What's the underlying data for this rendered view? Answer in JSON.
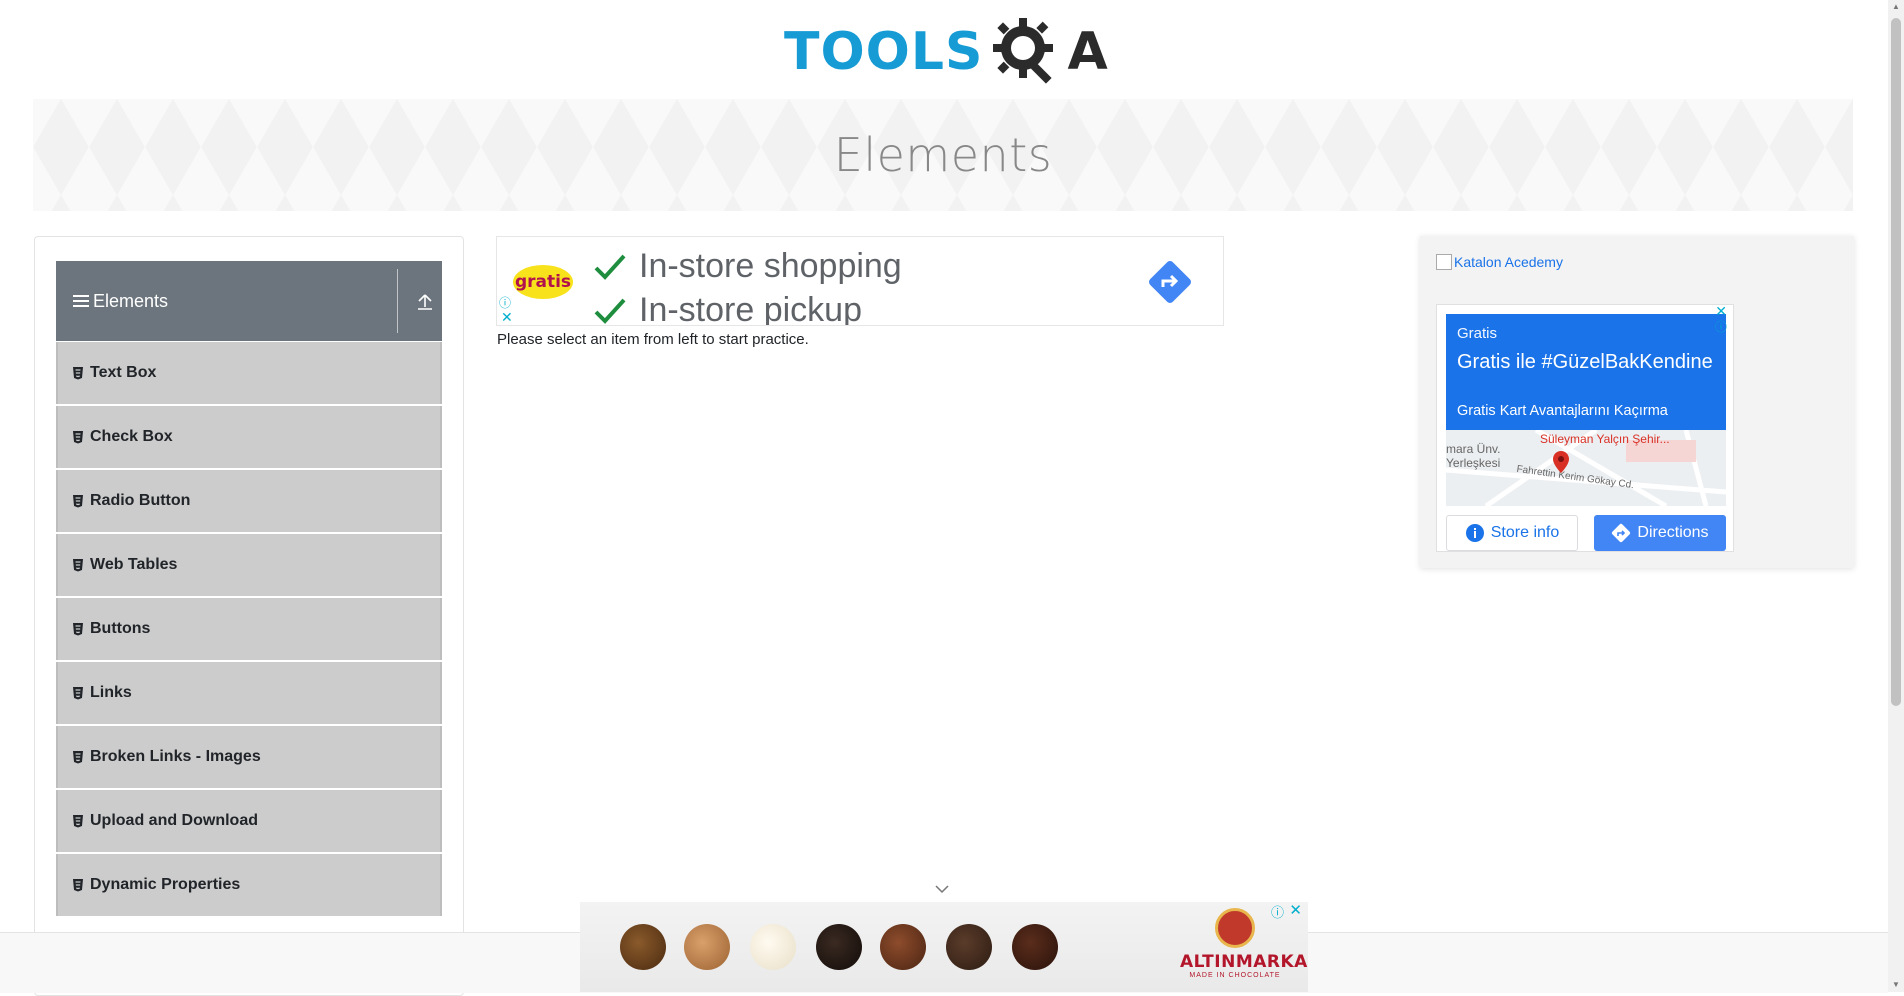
{
  "header": {
    "logo_text_tools": "TOOLS",
    "logo_text_a": "A",
    "brand_colors": {
      "tools": "#169bd5",
      "dark": "#2b2b2b"
    }
  },
  "banner": {
    "title": "Elements"
  },
  "sidebar": {
    "group_title": "Elements",
    "items": [
      {
        "label": "Text Box"
      },
      {
        "label": "Check Box"
      },
      {
        "label": "Radio Button"
      },
      {
        "label": "Web Tables"
      },
      {
        "label": "Buttons"
      },
      {
        "label": "Links"
      },
      {
        "label": "Broken Links - Images"
      },
      {
        "label": "Upload and Download"
      },
      {
        "label": "Dynamic Properties"
      }
    ]
  },
  "ad_center": {
    "brand": "gratis",
    "line1": "In-store shopping",
    "line2": "In-store pickup"
  },
  "main": {
    "instruction": "Please select an item from left to start practice."
  },
  "right_widget": {
    "image_alt": "Katalon Acedemy",
    "ad": {
      "brand": "Gratis",
      "headline": "Gratis ile #GüzelBakKendine",
      "description": "Gratis Kart Avantajlarını Kaçırma",
      "map_labels": [
        "Süleyman Yalçın Şehir...",
        "mara Ünv.",
        "Yerleşkesi",
        "Fahrettin Kerim Gökay Cd."
      ],
      "store_info_label": "Store info",
      "directions_label": "Directions"
    }
  },
  "bottom_ad": {
    "brand": "ALTINMARKA",
    "tagline": "MADE IN CHOCOLATE"
  },
  "colors": {
    "sidebar_header": "#6c757d",
    "menu_item": "#cccccc",
    "ad_blue": "#1a73e8",
    "ad_icon": "#00aecd"
  }
}
